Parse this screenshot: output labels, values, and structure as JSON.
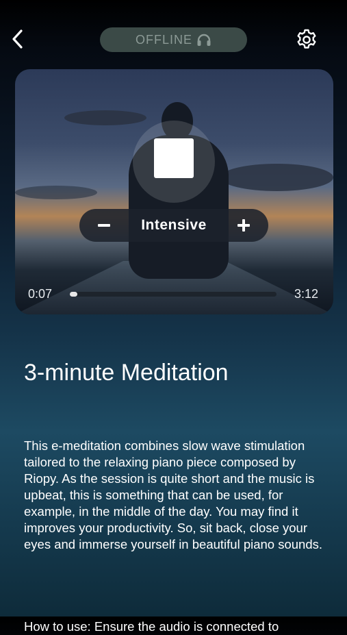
{
  "header": {
    "back_icon": "chevron-left-icon",
    "status_label": "OFFLINE",
    "status_icon": "headphones-icon",
    "settings_icon": "gear-icon"
  },
  "player": {
    "control_icon": "stop-icon",
    "intensity": {
      "decrease_label": "−",
      "label": "Intensive",
      "increase_label": "+"
    },
    "elapsed": "0:07",
    "duration": "3:12",
    "progress_fraction": 0.036
  },
  "content": {
    "title": "3-minute Meditation",
    "description": "This e-meditation combines slow wave stimulation tailored to the relaxing piano piece composed by Riopy. As the session is quite short and the music is upbeat, this is something that can be used, for example, in the middle of the day. You may find it improves your productivity. So, sit back, close your eyes and immerse yourself in beautiful piano sounds.",
    "how_to_use": "How to use: Ensure the audio is connected to"
  },
  "colors": {
    "pill_bg": "#3b4a47",
    "pill_text": "#8c9a96",
    "accent": "#ffffff"
  }
}
